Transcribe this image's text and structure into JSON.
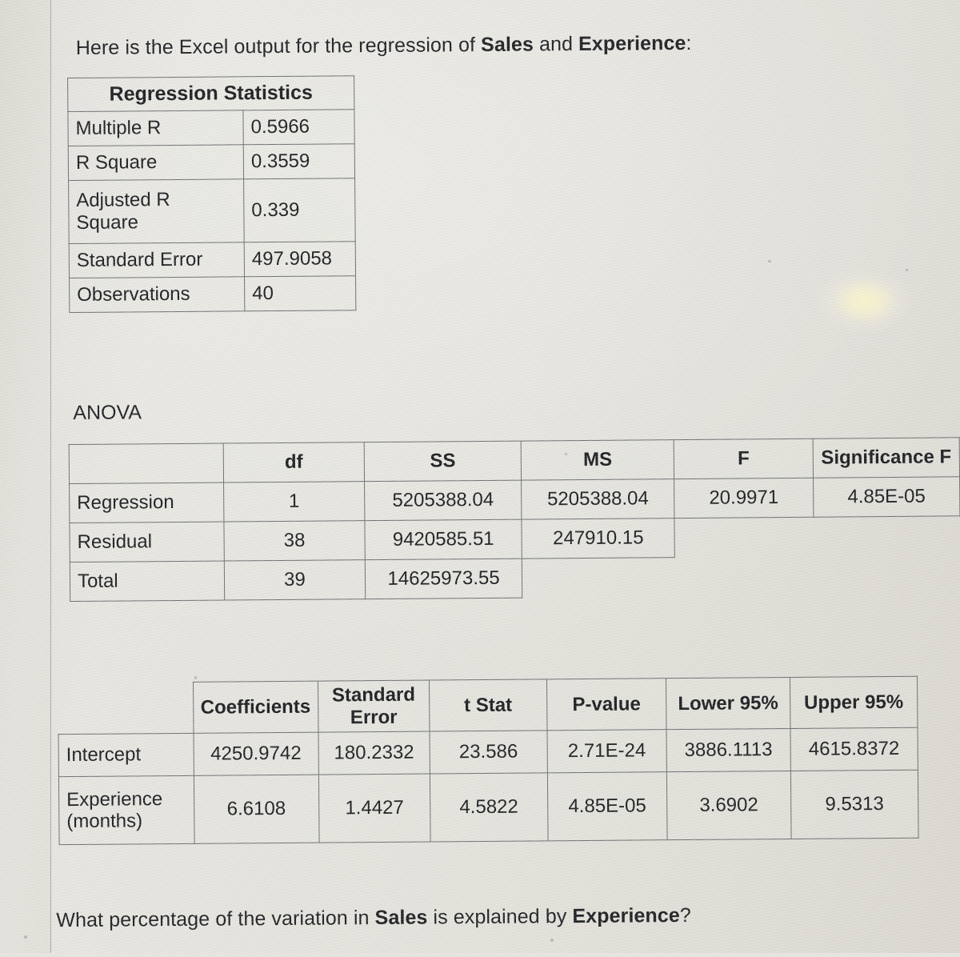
{
  "intro": {
    "prefix": "Here is the Excel output for the regression of ",
    "bold1": "Sales",
    "middle": " and ",
    "bold2": "Experience",
    "suffix": ":"
  },
  "regression_statistics": {
    "title": "Regression Statistics",
    "rows": [
      {
        "label": "Multiple R",
        "value": "0.5966"
      },
      {
        "label": "R Square",
        "value": "0.3559"
      },
      {
        "label": "Adjusted R Square",
        "value": "0.339"
      },
      {
        "label": "Standard Error",
        "value": "497.9058"
      },
      {
        "label": "Observations",
        "value": "40"
      }
    ]
  },
  "anova": {
    "label": "ANOVA",
    "headers": [
      "",
      "df",
      "SS",
      "MS",
      "F",
      "Significance F"
    ],
    "rows": [
      {
        "source": "Regression",
        "df": "1",
        "ss": "5205388.04",
        "ms": "5205388.04",
        "f": "20.9971",
        "sig": "4.85E-05"
      },
      {
        "source": "Residual",
        "df": "38",
        "ss": "9420585.51",
        "ms": "247910.15",
        "f": "",
        "sig": ""
      },
      {
        "source": "Total",
        "df": "39",
        "ss": "14625973.55",
        "ms": "",
        "f": "",
        "sig": ""
      }
    ]
  },
  "coefficients_table": {
    "headers": [
      "",
      "Coefficients",
      "Standard Error",
      "t Stat",
      "P-value",
      "Lower 95%",
      "Upper 95%"
    ],
    "header_standard_error_line1": "Standard",
    "header_standard_error_line2": "Error",
    "rows": [
      {
        "term": "Intercept",
        "term_line1": "Intercept",
        "term_line2": "",
        "coefficient": "4250.9742",
        "standard_error": "180.2332",
        "t_stat": "23.586",
        "p_value": "2.71E-24",
        "lower95": "3886.1113",
        "upper95": "4615.8372"
      },
      {
        "term": "Experience (months)",
        "term_line1": "Experience",
        "term_line2": "(months)",
        "coefficient": "6.6108",
        "standard_error": "1.4427",
        "t_stat": "4.5822",
        "p_value": "4.85E-05",
        "lower95": "3.6902",
        "upper95": "9.5313"
      }
    ]
  },
  "question": {
    "prefix": "What percentage of the variation in ",
    "bold1": "Sales",
    "middle": " is explained by ",
    "bold2": "Experience",
    "suffix": "?"
  },
  "colors": {
    "screen_background": "#e6e4de",
    "text": "#1d1f22",
    "table_border": "#6d7074",
    "glare": "#fffacd"
  }
}
